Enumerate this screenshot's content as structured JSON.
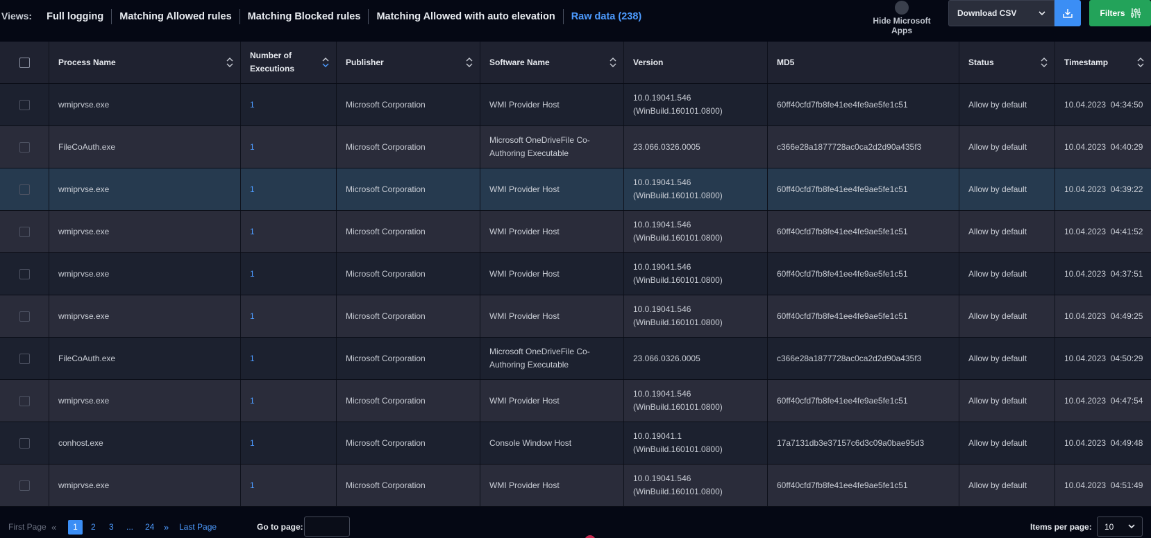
{
  "views": {
    "label": "Views:",
    "links": [
      {
        "label": "Full logging",
        "active": false
      },
      {
        "label": "Matching Allowed rules",
        "active": false
      },
      {
        "label": "Matching Blocked rules",
        "active": false
      },
      {
        "label": "Matching Allowed with auto elevation",
        "active": false
      },
      {
        "label": "Raw data (238)",
        "active": true
      }
    ]
  },
  "toolbar": {
    "hide_ms_label": "Hide Microsoft Apps",
    "download_label": "Download CSV",
    "filters_label": "Filters"
  },
  "table": {
    "headers": [
      {
        "label": "Process Name"
      },
      {
        "label": "Number of Executions"
      },
      {
        "label": "Publisher"
      },
      {
        "label": "Software Name"
      },
      {
        "label": "Version"
      },
      {
        "label": "MD5"
      },
      {
        "label": "Status"
      },
      {
        "label": "Timestamp"
      }
    ],
    "rows": [
      {
        "process": "wmiprvse.exe",
        "executions": "1",
        "publisher": "Microsoft Corporation",
        "software": "WMI Provider Host",
        "version1": "10.0.19041.546",
        "version2": "(WinBuild.160101.0800)",
        "md5": "60ff40cfd7fb8fe41ee4fe9ae5fe1c51",
        "status": "Allow by default",
        "timestamp": "10.04.2023  04:34:50"
      },
      {
        "process": "FileCoAuth.exe",
        "executions": "1",
        "publisher": "Microsoft Corporation",
        "software": "Microsoft OneDriveFile Co-Authoring Executable",
        "version1": "23.066.0326.0005",
        "version2": "",
        "md5": "c366e28a1877728ac0ca2d2d90a435f3",
        "status": "Allow by default",
        "timestamp": "10.04.2023  04:40:29"
      },
      {
        "process": "wmiprvse.exe",
        "executions": "1",
        "publisher": "Microsoft Corporation",
        "software": "WMI Provider Host",
        "version1": "10.0.19041.546",
        "version2": "(WinBuild.160101.0800)",
        "md5": "60ff40cfd7fb8fe41ee4fe9ae5fe1c51",
        "status": "Allow by default",
        "timestamp": "10.04.2023  04:39:22"
      },
      {
        "process": "wmiprvse.exe",
        "executions": "1",
        "publisher": "Microsoft Corporation",
        "software": "WMI Provider Host",
        "version1": "10.0.19041.546",
        "version2": "(WinBuild.160101.0800)",
        "md5": "60ff40cfd7fb8fe41ee4fe9ae5fe1c51",
        "status": "Allow by default",
        "timestamp": "10.04.2023  04:41:52"
      },
      {
        "process": "wmiprvse.exe",
        "executions": "1",
        "publisher": "Microsoft Corporation",
        "software": "WMI Provider Host",
        "version1": "10.0.19041.546",
        "version2": "(WinBuild.160101.0800)",
        "md5": "60ff40cfd7fb8fe41ee4fe9ae5fe1c51",
        "status": "Allow by default",
        "timestamp": "10.04.2023  04:37:51"
      },
      {
        "process": "wmiprvse.exe",
        "executions": "1",
        "publisher": "Microsoft Corporation",
        "software": "WMI Provider Host",
        "version1": "10.0.19041.546",
        "version2": "(WinBuild.160101.0800)",
        "md5": "60ff40cfd7fb8fe41ee4fe9ae5fe1c51",
        "status": "Allow by default",
        "timestamp": "10.04.2023  04:49:25"
      },
      {
        "process": "FileCoAuth.exe",
        "executions": "1",
        "publisher": "Microsoft Corporation",
        "software": "Microsoft OneDriveFile Co-Authoring Executable",
        "version1": "23.066.0326.0005",
        "version2": "",
        "md5": "c366e28a1877728ac0ca2d2d90a435f3",
        "status": "Allow by default",
        "timestamp": "10.04.2023  04:50:29"
      },
      {
        "process": "wmiprvse.exe",
        "executions": "1",
        "publisher": "Microsoft Corporation",
        "software": "WMI Provider Host",
        "version1": "10.0.19041.546",
        "version2": "(WinBuild.160101.0800)",
        "md5": "60ff40cfd7fb8fe41ee4fe9ae5fe1c51",
        "status": "Allow by default",
        "timestamp": "10.04.2023  04:47:54"
      },
      {
        "process": "conhost.exe",
        "executions": "1",
        "publisher": "Microsoft Corporation",
        "software": "Console Window Host",
        "version1": "10.0.19041.1",
        "version2": "(WinBuild.160101.0800)",
        "md5": "17a7131db3e37157c6d3c09a0bae95d3",
        "status": "Allow by default",
        "timestamp": "10.04.2023  04:49:48"
      },
      {
        "process": "wmiprvse.exe",
        "executions": "1",
        "publisher": "Microsoft Corporation",
        "software": "WMI Provider Host",
        "version1": "10.0.19041.546",
        "version2": "(WinBuild.160101.0800)",
        "md5": "60ff40cfd7fb8fe41ee4fe9ae5fe1c51",
        "status": "Allow by default",
        "timestamp": "10.04.2023  04:51:49"
      }
    ]
  },
  "pagination": {
    "first_label": "First Page",
    "pages": [
      "1",
      "2",
      "3",
      "...",
      "24"
    ],
    "current_page": "1",
    "last_label": "Last Page",
    "goto_label": "Go to page:",
    "goto_value": "",
    "items_per_page_label": "Items per page:",
    "items_per_page_value": "10"
  },
  "colors": {
    "accent": "#3b8ef5",
    "filters": "#23a35a",
    "link": "#4d9bff",
    "background": "#050814"
  }
}
